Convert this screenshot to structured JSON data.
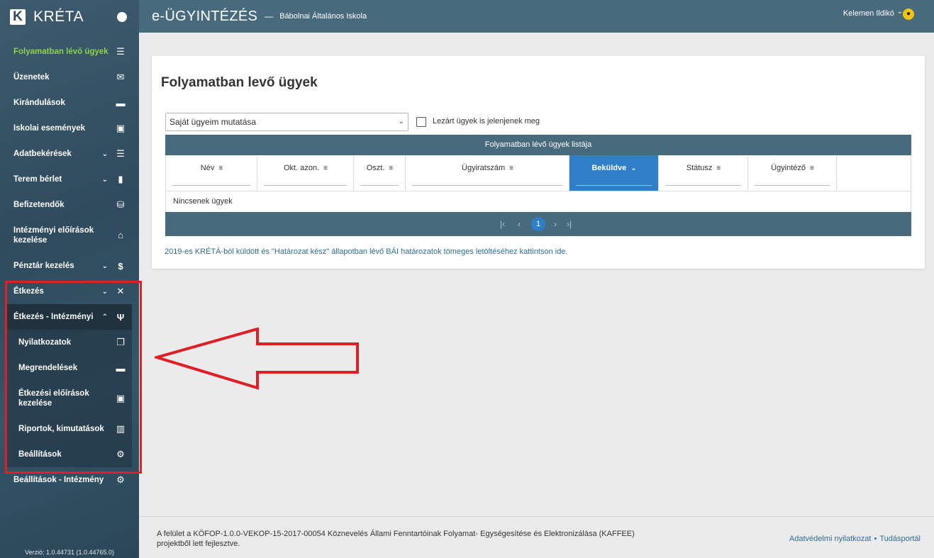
{
  "brand": {
    "logo": "K",
    "name": "KRÉTA"
  },
  "header": {
    "app_title": "e-ÜGYINTÉZÉS",
    "separator": "—",
    "school": "Bábolnai Általános Iskola",
    "user": "Kelemen Ildikó",
    "user_icon": "accessibility-icon"
  },
  "sidebar": {
    "items": [
      {
        "label": "Folyamatban lévő ügyek",
        "icon": "list-icon",
        "active": true
      },
      {
        "label": "Üzenetek",
        "icon": "envelope-icon"
      },
      {
        "label": "Kirándulások",
        "icon": "bed-icon"
      },
      {
        "label": "Iskolai események",
        "icon": "calendar-icon"
      },
      {
        "label": "Adatbekérések",
        "icon": "list-icon"
      },
      {
        "label": "Terem bérlet",
        "icon": "door-icon"
      },
      {
        "label": "Befizetendők",
        "icon": "payment-icon"
      },
      {
        "label": "Intézményi előírások kezelése",
        "icon": "institution-icon"
      },
      {
        "label": "Pénztár kezelés",
        "icon": "dollar-icon"
      },
      {
        "label": "Étkezés",
        "icon": "cutlery-icon"
      }
    ],
    "subgroup": {
      "label": "Étkezés - Intézményi",
      "icon": "fork-knife-icon",
      "items": [
        {
          "label": "Nyilatkozatok",
          "icon": "library-icon"
        },
        {
          "label": "Megrendelések",
          "icon": "folder-icon"
        },
        {
          "label": "Étkezési előírások kezelése",
          "icon": "folder-account-icon"
        },
        {
          "label": "Riportok, kimutatások",
          "icon": "chart-icon"
        },
        {
          "label": "Beállítások",
          "icon": "gear-icon"
        }
      ]
    },
    "bottom_item": {
      "label": "Beállítások - Intézmény",
      "icon": "gear-icon"
    },
    "version": "Verzió: 1.0.44731 (1.0.44765.0)"
  },
  "main": {
    "title": "Folyamatban levő ügyek",
    "filter_select": "Saját ügyeim mutatása",
    "closed_checkbox_label": "Lezárt ügyek is jelenjenek meg",
    "grid": {
      "title": "Folyamatban lévő ügyek listája",
      "columns": [
        "Név",
        "Okt. azon.",
        "Oszt.",
        "Ügyiratszám",
        "Beküldve",
        "Státusz",
        "Ügyintéző"
      ],
      "sorted_column": "Beküldve",
      "empty_text": "Nincsenek ügyek",
      "pager": {
        "current_page": "1"
      }
    },
    "note_link": "2019-es KRÉTÁ-ból küldött és \"Határozat kész\" állapotban lévő BÁI határozatok tömeges letöltéséhez kattintson ide."
  },
  "footer": {
    "text": "A felület a KÖFOP-1.0.0-VEKOP-15-2017-00054 Köznevelés Állami Fenntartóinak Folyamat- Egységesítése és Elektronizálása (KAFFEE) projektből lett fejlesztve.",
    "link_privacy": "Adatvédelmi nyilatkozat",
    "link_sep": "•",
    "link_knowledge": "Tudásportál"
  },
  "colors": {
    "sidebar": "#2f4b5d",
    "header": "#486a7d",
    "active_nav": "#8fd14f",
    "sorted_column": "#2f7ec7",
    "annotation": "#e01e25"
  }
}
